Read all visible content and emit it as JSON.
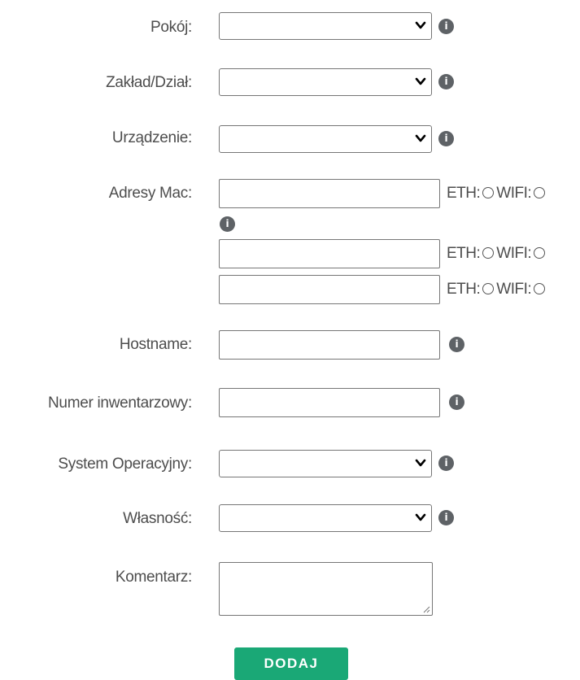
{
  "form": {
    "room_label": "Pokój:",
    "department_label": "Zakład/Dział:",
    "device_label": "Urządzenie:",
    "mac_label": "Adresy Mac:",
    "mac_rows": [
      {
        "eth": "ETH:",
        "wifi": "WIFI:"
      },
      {
        "eth": "ETH:",
        "wifi": "WIFI:"
      },
      {
        "eth": "ETH:",
        "wifi": "WIFI:"
      }
    ],
    "hostname_label": "Hostname:",
    "inventory_label": "Numer inwentarzowy:",
    "os_label": "System Operacyjny:",
    "ownership_label": "Własność:",
    "comment_label": "Komentarz:",
    "submit_label": "DODAJ",
    "info_glyph": "i"
  },
  "colors": {
    "button": "#1aa876",
    "info": "#5e6266"
  }
}
